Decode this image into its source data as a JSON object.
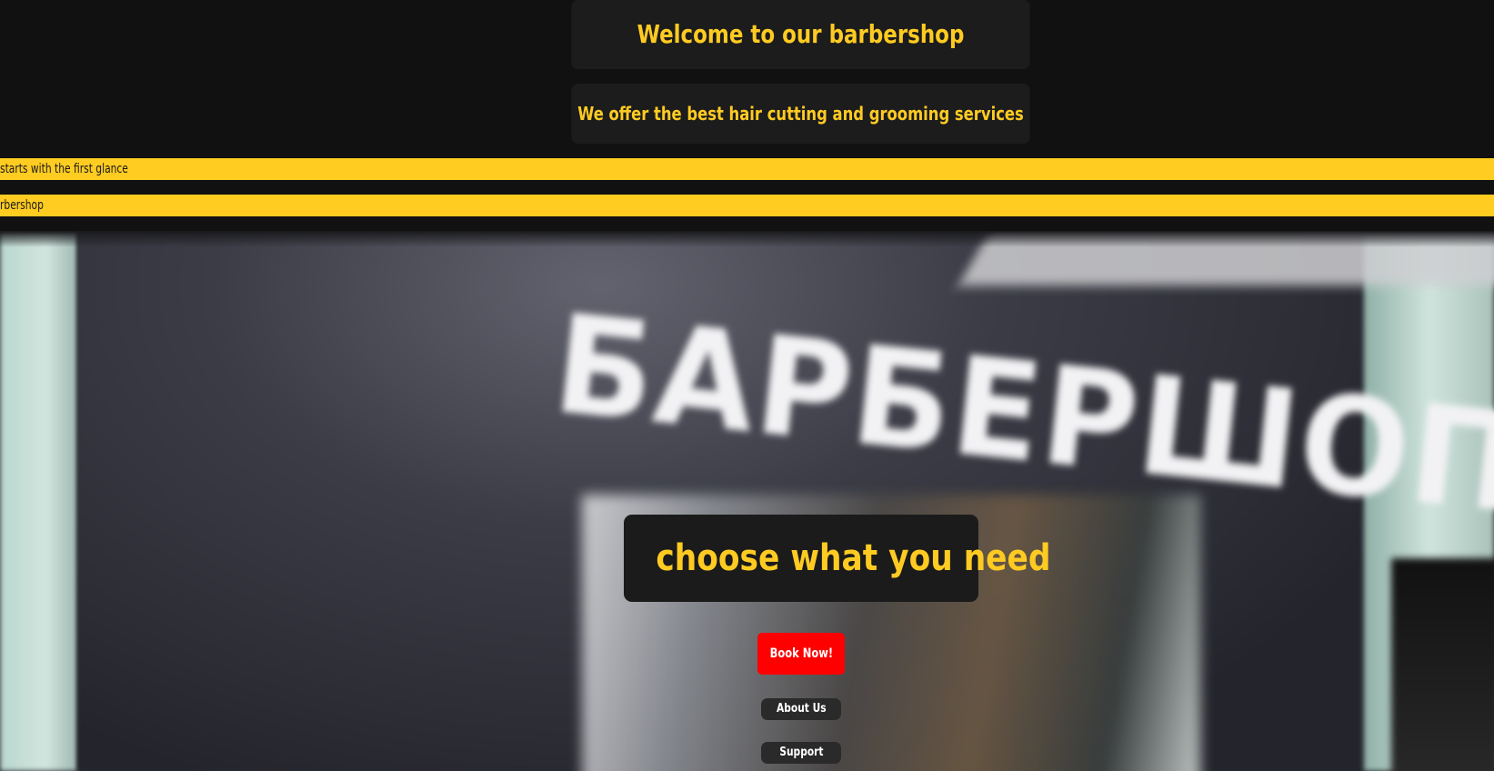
{
  "header": {
    "welcome": "Welcome to our barbershop",
    "offer": "We offer the best hair cutting and grooming services"
  },
  "tickers": [
    "starts with the first glance",
    "rbershop"
  ],
  "hero": {
    "sign_text": "БАРБЕРШОП",
    "headline": "choose what you need"
  },
  "actions": {
    "book": "Book Now!",
    "about": "About Us",
    "support": "Support"
  },
  "colors": {
    "accent": "#ffcb22",
    "book_button": "#ff0000",
    "background": "#111111"
  }
}
